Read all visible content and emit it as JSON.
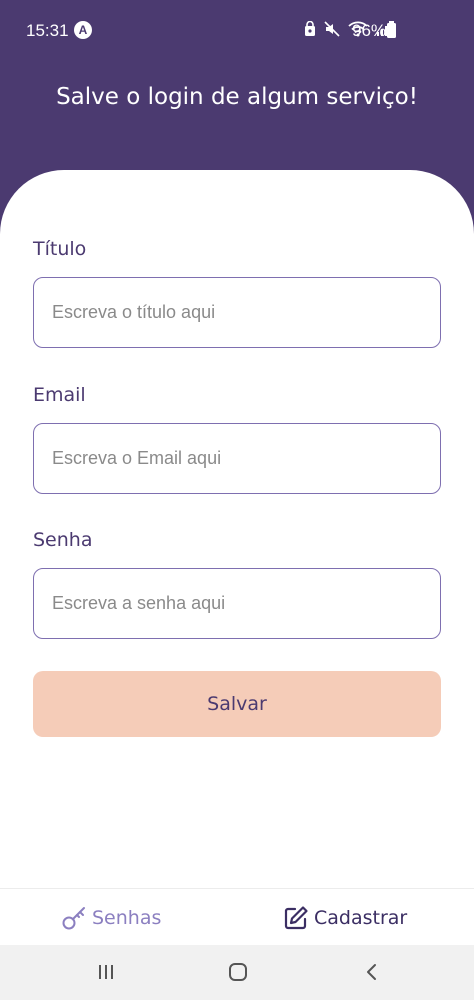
{
  "status_bar": {
    "time": "15:31",
    "battery": "96%"
  },
  "header": {
    "title": "Salve o login de algum serviço!"
  },
  "form": {
    "title_field": {
      "label": "Título",
      "placeholder": "Escreva o título aqui",
      "value": ""
    },
    "email_field": {
      "label": "Email",
      "placeholder": "Escreva o Email aqui",
      "value": ""
    },
    "password_field": {
      "label": "Senha",
      "placeholder": "Escreva a senha aqui",
      "value": ""
    },
    "save_label": "Salvar"
  },
  "bottom_nav": {
    "items": [
      {
        "label": "Senhas",
        "icon": "key-icon",
        "active": true
      },
      {
        "label": "Cadastrar",
        "icon": "edit-icon",
        "active": false
      }
    ]
  },
  "system_nav": {
    "buttons": [
      "recents-icon",
      "home-icon",
      "back-icon"
    ]
  },
  "colors": {
    "primary": "#4b3a70",
    "accent": "#f5ccb8",
    "inactive_nav": "#8b7fc0"
  }
}
